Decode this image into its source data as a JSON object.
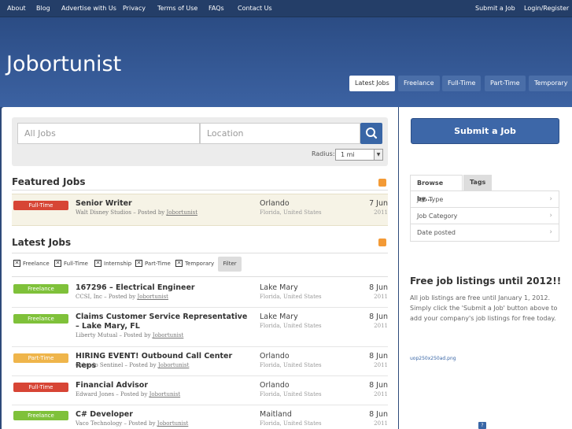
{
  "topnav": {
    "left": [
      "About",
      "Blog",
      "Advertise with Us",
      "Privacy",
      "Terms of Use",
      "FAQs",
      "Contact Us"
    ],
    "submit": "Submit a Job",
    "login": "Login/Register"
  },
  "header": {
    "logo": "Jobortunist",
    "tabs": [
      "Latest Jobs",
      "Freelance",
      "Full-Time",
      "Part-Time",
      "Temporary"
    ]
  },
  "search": {
    "jobs_placeholder": "All Jobs",
    "location_placeholder": "Location",
    "radius_label": "Radius:",
    "radius_value": "1 mi"
  },
  "featured": {
    "title": "Featured Jobs",
    "jobs": [
      {
        "type": "Full-Time",
        "title": "Senior Writer",
        "company": "Walt Disney Studios",
        "posted_by": "Jobortunist",
        "city": "Orlando",
        "region": "Florida, United States",
        "date": "7 Jun",
        "year": "2011"
      }
    ]
  },
  "latest": {
    "title": "Latest Jobs",
    "filters": [
      "Freelance",
      "Full-Time",
      "Internship",
      "Part-Time",
      "Temporary"
    ],
    "filter_button": "Filter",
    "jobs": [
      {
        "type": "Freelance",
        "title": "167296 – Electrical Engineer",
        "company": "CCSI, Inc",
        "posted_by": "Jobortunist",
        "city": "Lake Mary",
        "region": "Florida, United States",
        "date": "8 Jun",
        "year": "2011"
      },
      {
        "type": "Freelance",
        "title": "Claims Customer Service Representative – Lake Mary, FL",
        "company": "Liberty Mutual",
        "posted_by": "Jobortunist",
        "city": "Lake Mary",
        "region": "Florida, United States",
        "date": "8 Jun",
        "year": "2011"
      },
      {
        "type": "Part-Time",
        "title": "HIRING EVENT! Outbound Call Center Reps",
        "company": "Orlando Sentinel",
        "posted_by": "Jobortunist",
        "city": "Orlando",
        "region": "Florida, United States",
        "date": "8 Jun",
        "year": "2011"
      },
      {
        "type": "Full-Time",
        "title": "Financial Advisor",
        "company": "Edward Jones",
        "posted_by": "Jobortunist",
        "city": "Orlando",
        "region": "Florida, United States",
        "date": "8 Jun",
        "year": "2011"
      },
      {
        "type": "Freelance",
        "title": "C# Developer",
        "company": "Vaco Technology",
        "posted_by": "Jobortunist",
        "city": "Maitland",
        "region": "Florida, United States",
        "date": "8 Jun",
        "year": "2011"
      }
    ]
  },
  "sidebar": {
    "submit_button": "Submit a Job",
    "tab_browse": "Browse by...",
    "tab_tags": "Tags",
    "browse_items": [
      "Job Type",
      "Job Category",
      "Date posted"
    ],
    "promo_title": "Free job listings until 2012!!",
    "promo_text": "All job listings are free until January 1, 2012. Simply click the 'Submit a Job' button above to add your company's job listings for free today.",
    "ad_text": "uop250x250ad.png"
  },
  "colors": {
    "full_time": "#d74535",
    "freelance": "#7fc13a",
    "part_time": "#efb54b",
    "brand_blue": "#3d67a8"
  }
}
